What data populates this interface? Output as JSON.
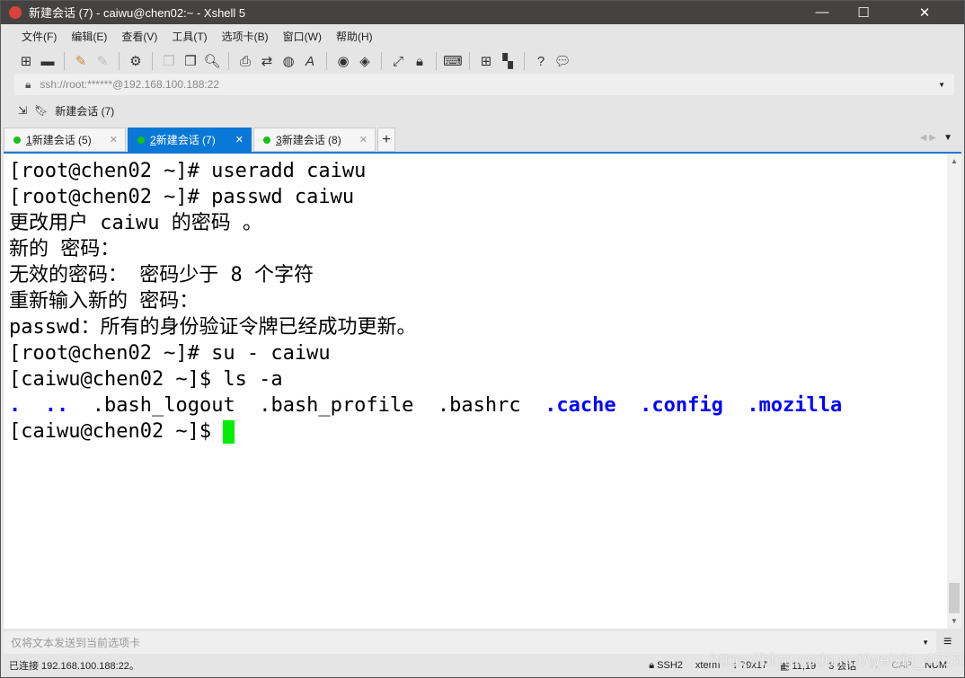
{
  "window": {
    "title": "新建会话 (7) - caiwu@chen02:~ - Xshell 5",
    "minimize": "—",
    "maximize": "☐",
    "close": "✕"
  },
  "menu": [
    "文件(F)",
    "编辑(E)",
    "查看(V)",
    "工具(T)",
    "选项卡(B)",
    "窗口(W)",
    "帮助(H)"
  ],
  "toolbar_icons": [
    "new-session-icon",
    "open-folder-icon",
    "connect-icon",
    "disconnect-icon",
    "properties-icon",
    "copy-icon",
    "paste-icon",
    "find-icon",
    "print-icon",
    "transfer-icon",
    "globe-icon",
    "font-icon",
    "xftp-icon",
    "xmanager-icon",
    "fullscreen-icon",
    "lock-icon",
    "keyboard-icon",
    "new-tab-group-icon",
    "layout-icon",
    "help-icon",
    "chat-icon"
  ],
  "address": {
    "value": "ssh://root:******@192.168.100.188:22"
  },
  "session_bar": {
    "label": "新建会话 (7)"
  },
  "tabs": [
    {
      "num": "1",
      "label": " 新建会话 (5)",
      "active": false
    },
    {
      "num": "2",
      "label": " 新建会话 (7)",
      "active": true
    },
    {
      "num": "3",
      "label": " 新建会话 (8)",
      "active": false
    }
  ],
  "terminal": {
    "lines": [
      "[root@chen02 ~]# useradd caiwu",
      "[root@chen02 ~]# passwd caiwu",
      "更改用户 caiwu 的密码 。",
      "新的 密码：",
      "无效的密码： 密码少于 8 个字符",
      "重新输入新的 密码：",
      "passwd：所有的身份验证令牌已经成功更新。",
      "[root@chen02 ~]# su - caiwu",
      "[caiwu@chen02 ~]$ ls -a"
    ],
    "ls_output": [
      {
        "name": ".",
        "dir": true
      },
      {
        "name": "..",
        "dir": true
      },
      {
        "name": ".bash_logout",
        "dir": false
      },
      {
        "name": ".bash_profile",
        "dir": false
      },
      {
        "name": ".bashrc",
        "dir": false
      },
      {
        "name": ".cache",
        "dir": true
      },
      {
        "name": ".config",
        "dir": true
      },
      {
        "name": ".mozilla",
        "dir": true
      }
    ],
    "prompt": "[caiwu@chen02 ~]$ ",
    "cursor_color": "#00ee00",
    "dir_color": "#0000ff"
  },
  "send_bar": {
    "placeholder": "仅将文本发送到当前选项卡"
  },
  "status": {
    "connection": "已连接 192.168.100.188:22。",
    "protocol": "SSH2",
    "term": "xterm",
    "size": "79x17",
    "position": "11,19",
    "sessions": "3 会话",
    "cap": "CAP",
    "num": "NUM"
  },
  "watermark": "https://blog.csdn.net/weixin_47151650"
}
